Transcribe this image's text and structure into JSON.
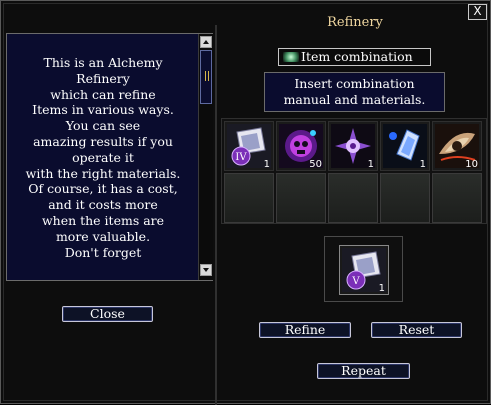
{
  "window": {
    "title": "Refinery",
    "close_glyph": "X"
  },
  "description": {
    "lines": [
      "This is an Alchemy",
      "Refinery",
      "which can refine",
      "Items in various ways.",
      "You can see",
      "amazing results if you",
      "operate it",
      "with the right materials.",
      "Of course, it has a cost,",
      "and it costs more",
      "when the items are",
      "more valuable.",
      "Don't forget"
    ]
  },
  "buttons": {
    "close": "Close",
    "refine": "Refine",
    "reset": "Reset",
    "repeat": "Repeat"
  },
  "combination": {
    "mode_label": "Item combination",
    "instruction": "Insert combination\nmanual and materials."
  },
  "materials": [
    {
      "icon": "combination-manual-icon",
      "count": "1"
    },
    {
      "icon": "purple-skull-orb-icon",
      "count": "50"
    },
    {
      "icon": "violet-crystal-cross-icon",
      "count": "1"
    },
    {
      "icon": "blue-gem-icon",
      "count": "1"
    },
    {
      "icon": "eye-relic-icon",
      "count": "10"
    }
  ],
  "result": {
    "icon": "combination-manual-icon",
    "count": "1"
  }
}
